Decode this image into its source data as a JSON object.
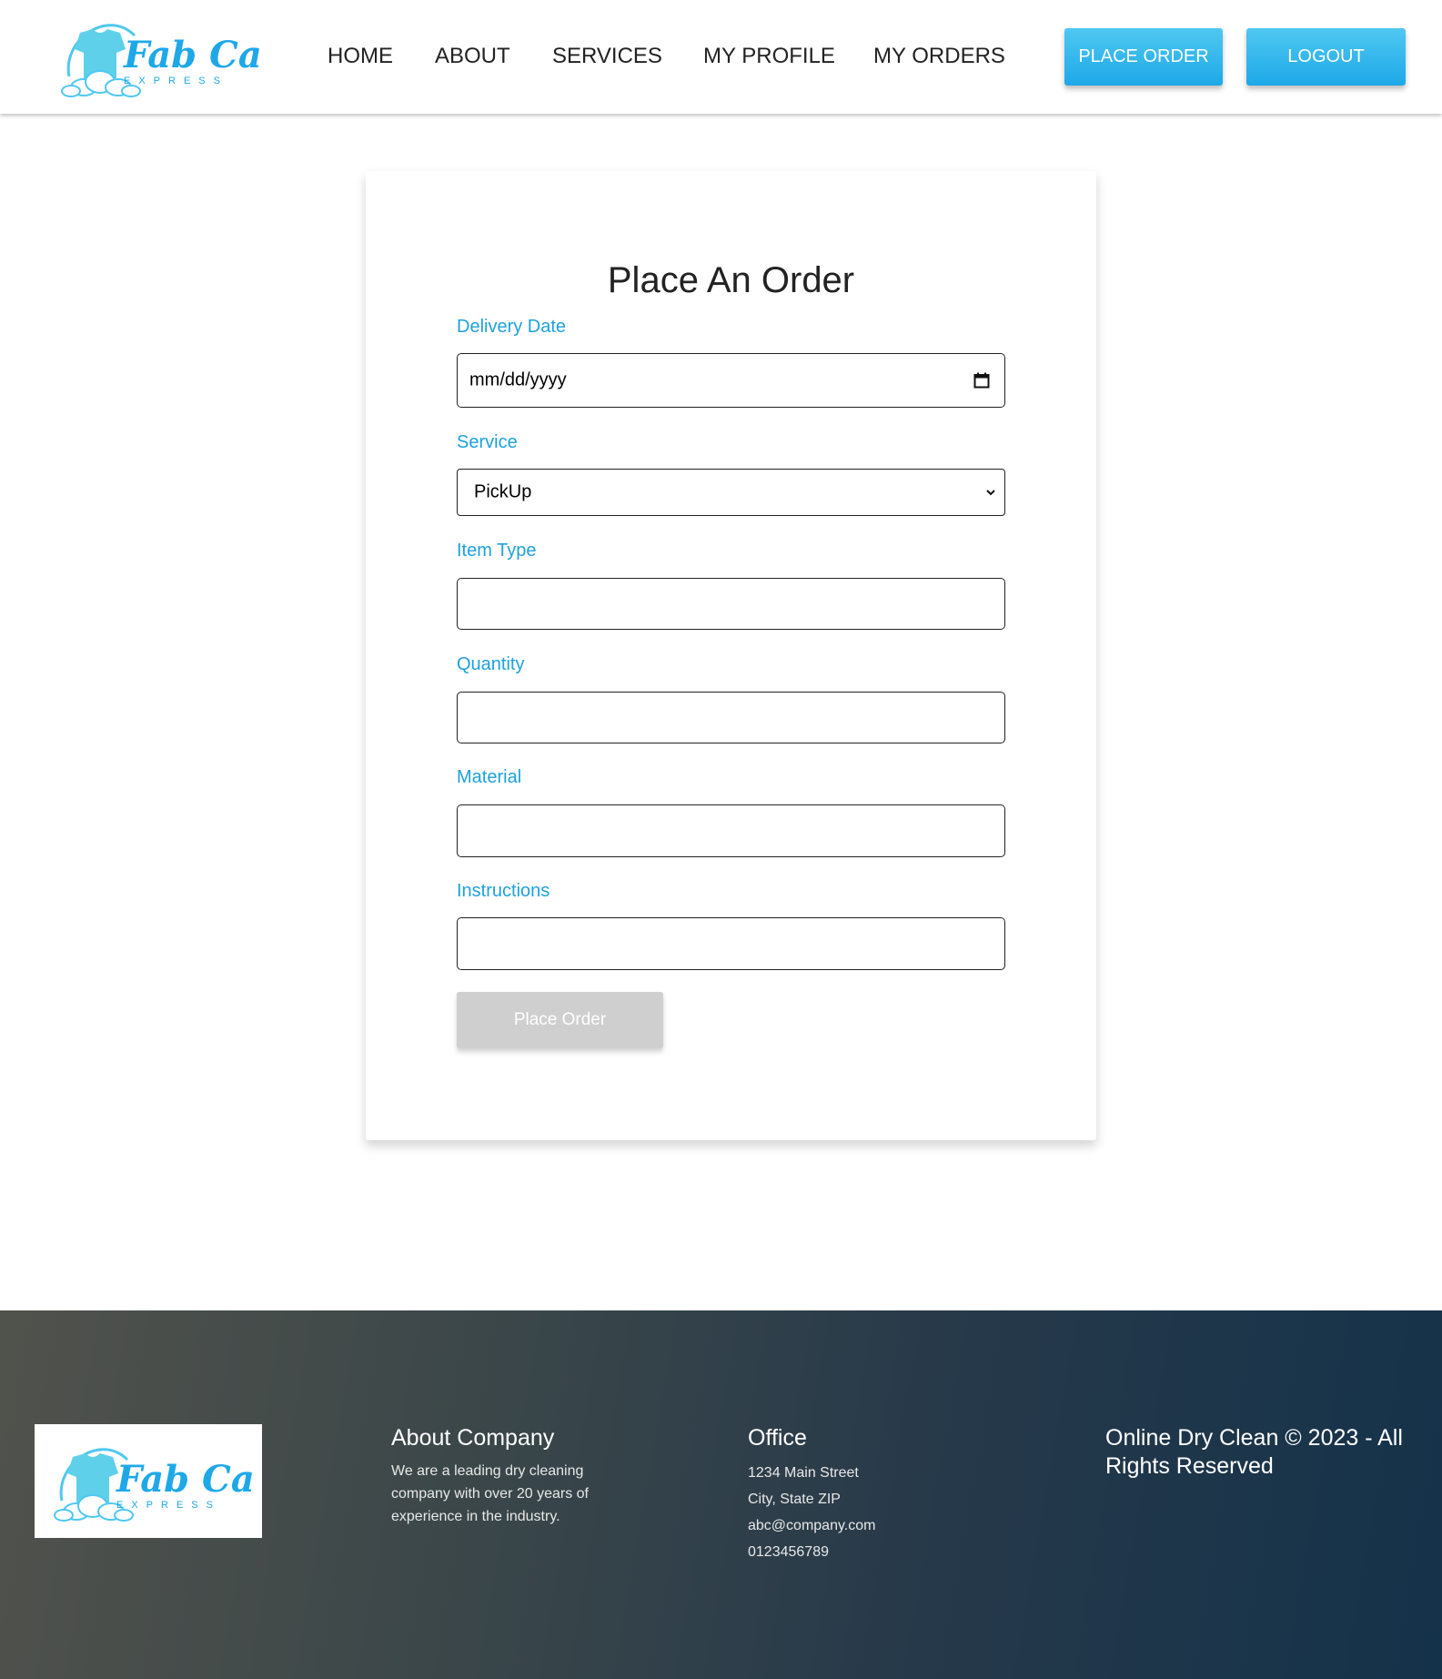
{
  "brand": {
    "logo_title": "Fab Care",
    "logo_subtitle": "EXPRESS",
    "accent": "#1ea1dc"
  },
  "nav": {
    "home": "HOME",
    "about": "ABOUT",
    "services": "SERVICES",
    "profile": "MY PROFILE",
    "orders": "MY ORDERS",
    "place_order": "PLACE ORDER",
    "logout": "LOGOUT"
  },
  "form": {
    "title": "Place An Order",
    "delivery_label": "Delivery Date",
    "delivery_value": "mm/dd/yyyy",
    "service_label": "Service",
    "service_value": "PickUp",
    "item_label": "Item Type",
    "quantity_label": "Quantity",
    "material_label": "Material",
    "instructions_label": "Instructions",
    "submit_label": "Place Order"
  },
  "footer": {
    "about_title": "About Company",
    "about_text": "We are a leading dry cleaning company with over 20 years of experience in the industry.",
    "about_line1": "We are a leading dry cleaning",
    "about_line2": "company with over 20 years of",
    "about_line3": "experience in the industry.",
    "office_title": "Office",
    "address1": "1234 Main Street",
    "address2": "City, State ZIP",
    "email": "abc@company.com",
    "phone": "0123456789",
    "copyright_line1": "Online Dry Clean © 2023 - All",
    "copyright_line2": "Rights Reserved"
  },
  "icons": {
    "calendar": "calendar-icon",
    "dropdown": "chevron-down-icon",
    "logo_shirt": "shirt-icon",
    "logo_cloud": "cloud-icon"
  }
}
